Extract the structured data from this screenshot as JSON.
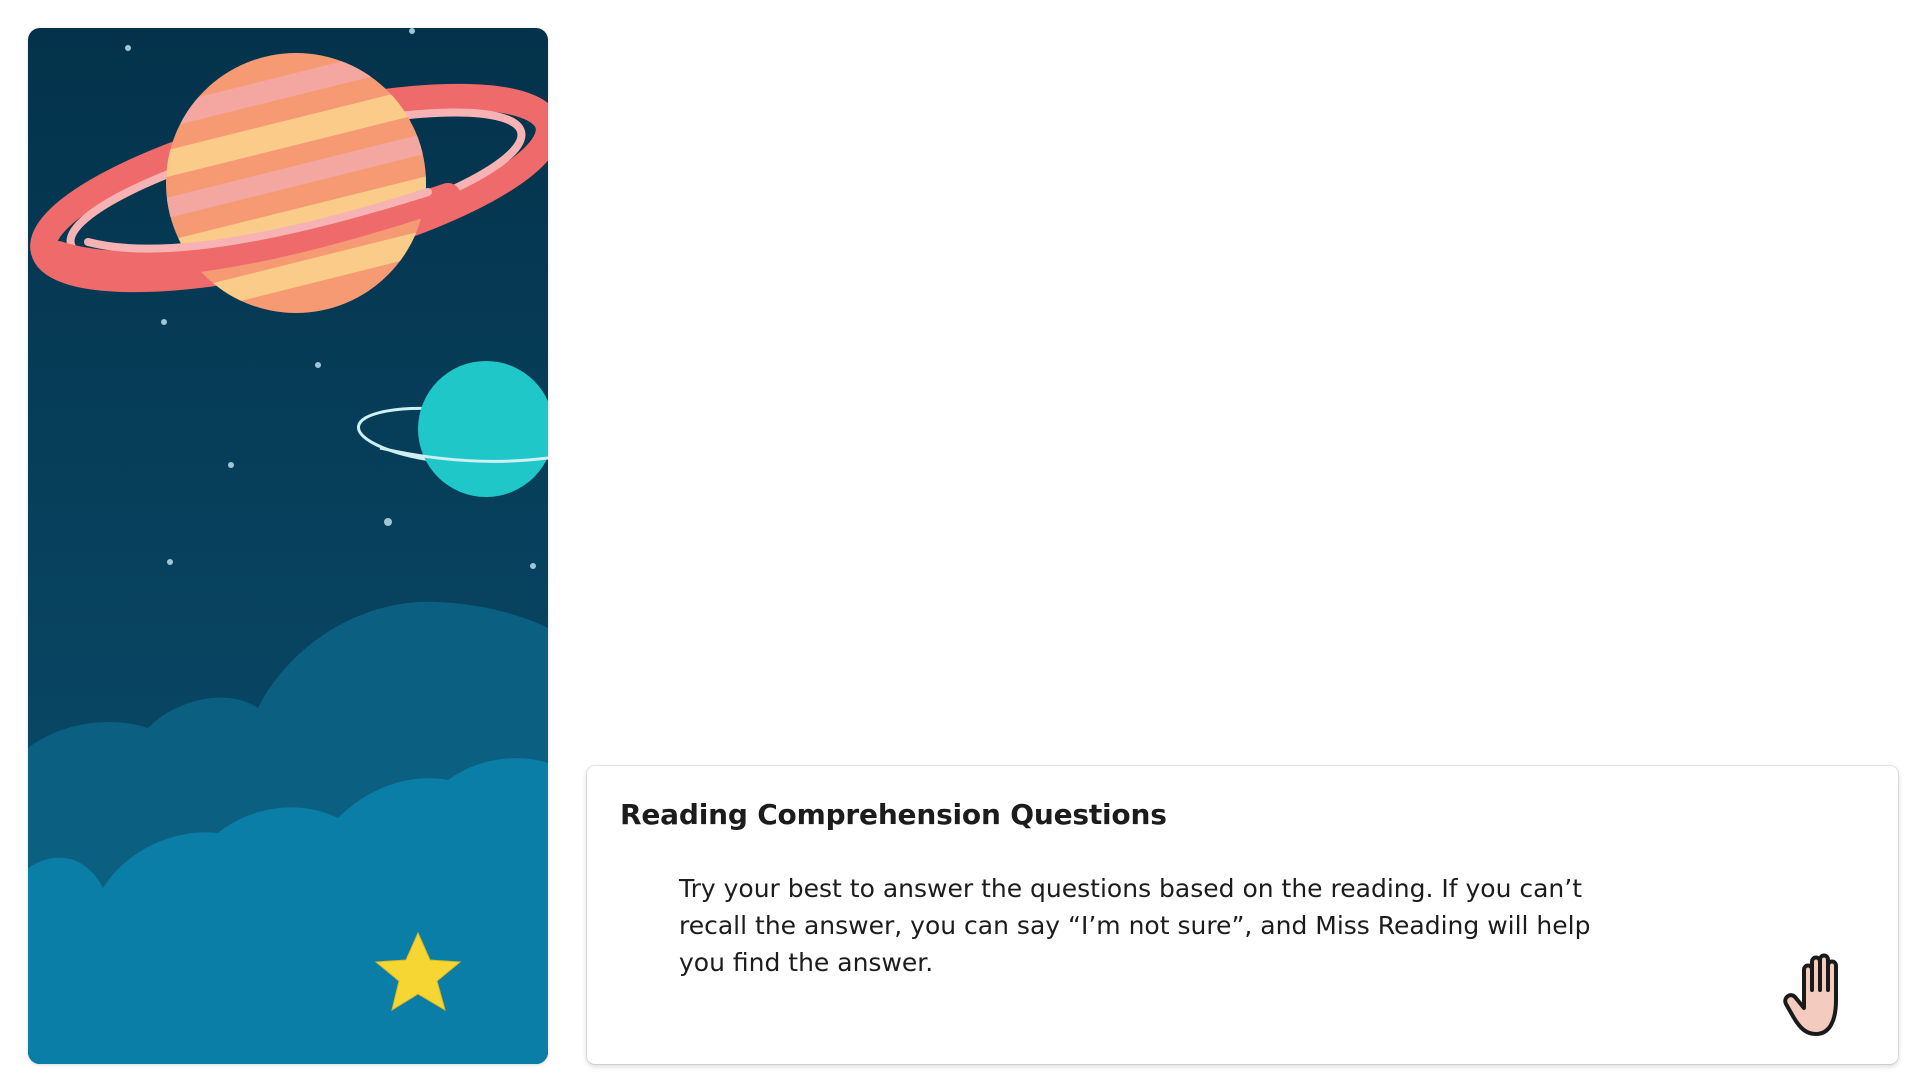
{
  "illustration": {
    "icon": "space-scene-illustration",
    "colors": {
      "sky_dark": "#053650",
      "sky_mid": "#0b4a66",
      "cloud_back": "#0d6a8c",
      "cloud_front": "#0a7ea6",
      "planet_orange": "#f59a73",
      "planet_pink": "#f4a7a0",
      "planet_cream": "#fbcb8a",
      "ring_coral": "#ef6b6b",
      "ring_pink": "#f7b3b3",
      "small_planet": "#1fc7c9",
      "star_yellow": "#f6d632"
    }
  },
  "instructions": {
    "title": "Reading Comprehension Questions",
    "body": "Try your best to answer the questions based on the reading. If you can’t recall the answer, you can say “I’m not sure”, and Miss Reading will help you find the answer."
  },
  "raise_hand": {
    "icon": "raised-hand-icon",
    "fill_color": "#f3cbbf"
  }
}
